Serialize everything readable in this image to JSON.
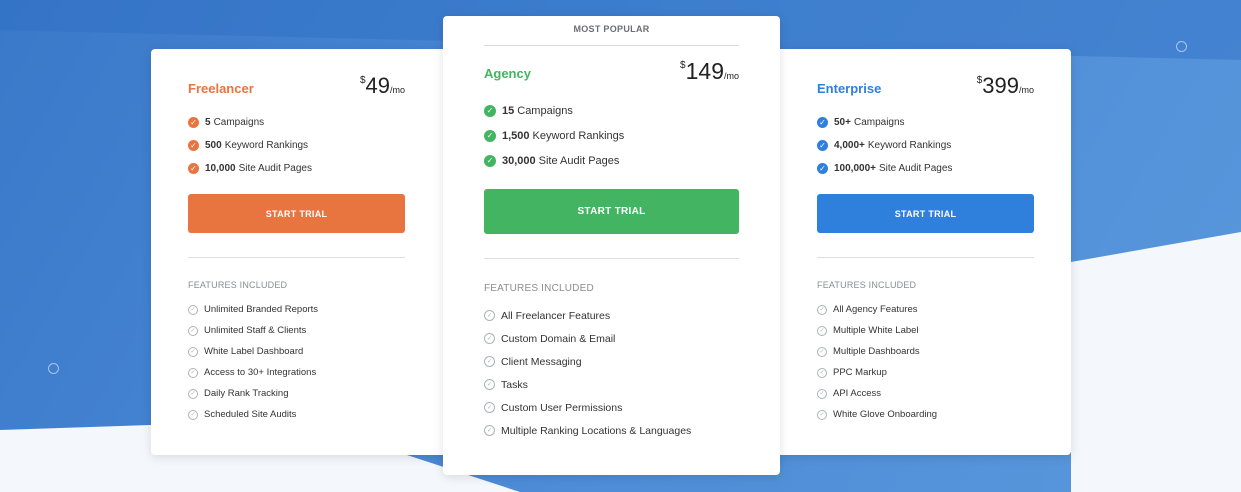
{
  "colors": {
    "freelancer": "#e8743f",
    "agency": "#43b562",
    "enterprise": "#2f7fdc"
  },
  "agency_badge": "MOST POPULAR",
  "plans": {
    "freelancer": {
      "name": "Freelancer",
      "currency": "$",
      "amount": "49",
      "period": "/mo",
      "stats": [
        {
          "value": "5",
          "label": "Campaigns"
        },
        {
          "value": "500",
          "label": "Keyword Rankings"
        },
        {
          "value": "10,000",
          "label": "Site Audit Pages"
        }
      ],
      "cta": "START TRIAL",
      "features_heading": "FEATURES INCLUDED",
      "features": [
        "Unlimited Branded Reports",
        "Unlimited Staff & Clients",
        "White Label Dashboard",
        "Access to 30+ Integrations",
        "Daily Rank Tracking",
        "Scheduled Site Audits"
      ]
    },
    "agency": {
      "name": "Agency",
      "currency": "$",
      "amount": "149",
      "period": "/mo",
      "stats": [
        {
          "value": "15",
          "label": "Campaigns"
        },
        {
          "value": "1,500",
          "label": "Keyword Rankings"
        },
        {
          "value": "30,000",
          "label": "Site Audit Pages"
        }
      ],
      "cta": "START TRIAL",
      "features_heading": "FEATURES INCLUDED",
      "features": [
        "All Freelancer Features",
        "Custom Domain & Email",
        "Client Messaging",
        "Tasks",
        "Custom User Permissions",
        "Multiple Ranking Locations & Languages"
      ]
    },
    "enterprise": {
      "name": "Enterprise",
      "currency": "$",
      "amount": "399",
      "period": "/mo",
      "stats": [
        {
          "value": "50+",
          "label": "Campaigns"
        },
        {
          "value": "4,000+",
          "label": "Keyword Rankings"
        },
        {
          "value": "100,000+",
          "label": "Site Audit Pages"
        }
      ],
      "cta": "START TRIAL",
      "features_heading": "FEATURES INCLUDED",
      "features": [
        "All Agency Features",
        "Multiple White Label",
        "Multiple Dashboards",
        "PPC Markup",
        "API Access",
        "White Glove Onboarding"
      ]
    }
  }
}
